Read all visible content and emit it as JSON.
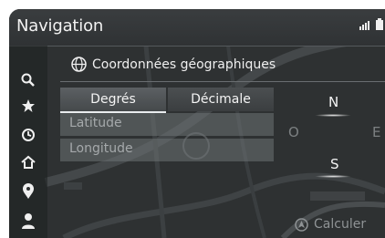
{
  "header": {
    "title": "Navigation"
  },
  "sidebar": {
    "items": [
      {
        "icon": "search-icon"
      },
      {
        "icon": "star-icon"
      },
      {
        "icon": "history-icon"
      },
      {
        "icon": "home-icon"
      },
      {
        "icon": "location-pin-icon"
      },
      {
        "icon": "person-icon"
      }
    ]
  },
  "section": {
    "icon": "globe-icon",
    "title": "Coordonnées géographiques"
  },
  "tabs": [
    {
      "label": "Degrés",
      "active": true
    },
    {
      "label": "Décimale",
      "active": false
    }
  ],
  "fields": [
    {
      "placeholder": "Latitude"
    },
    {
      "placeholder": "Longitude"
    }
  ],
  "compass": {
    "north": "N",
    "south": "S",
    "west": "O",
    "east": "E"
  },
  "calculate": {
    "label": "Calculer"
  },
  "colors": {
    "accent": "#f4f4f4",
    "map": "#2d3031",
    "muted": "#a5a9ab"
  }
}
